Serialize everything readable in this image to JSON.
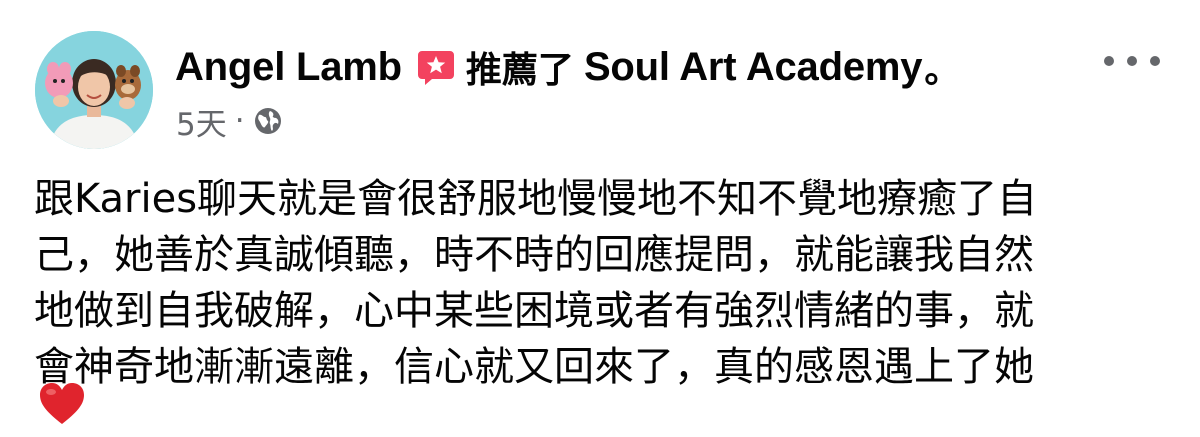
{
  "post": {
    "author_name": "Angel Lamb",
    "action_text": "推薦了",
    "page_name": "Soul Art Academy",
    "end_mark": "。",
    "timestamp": "5天",
    "separator": "·",
    "privacy_icon": "globe-icon",
    "recommend_icon": "recommend-star-icon",
    "recommend_color": "#f3425f",
    "more_icon": "more-options-icon",
    "body_lines": [
      "跟Karies聊天就是會很舒服地慢慢地不知不覺地療癒了自",
      "己，她善於真誠傾聽，時不時的回應提問，就能讓我自然",
      "地做到自我破解，心中某些困境或者有強烈情緒的事，就",
      "會神奇地漸漸遠離，信心就又回來了，真的感恩遇上了她"
    ],
    "emoji": "heart-emoji",
    "heart_color": "#e0242d"
  }
}
